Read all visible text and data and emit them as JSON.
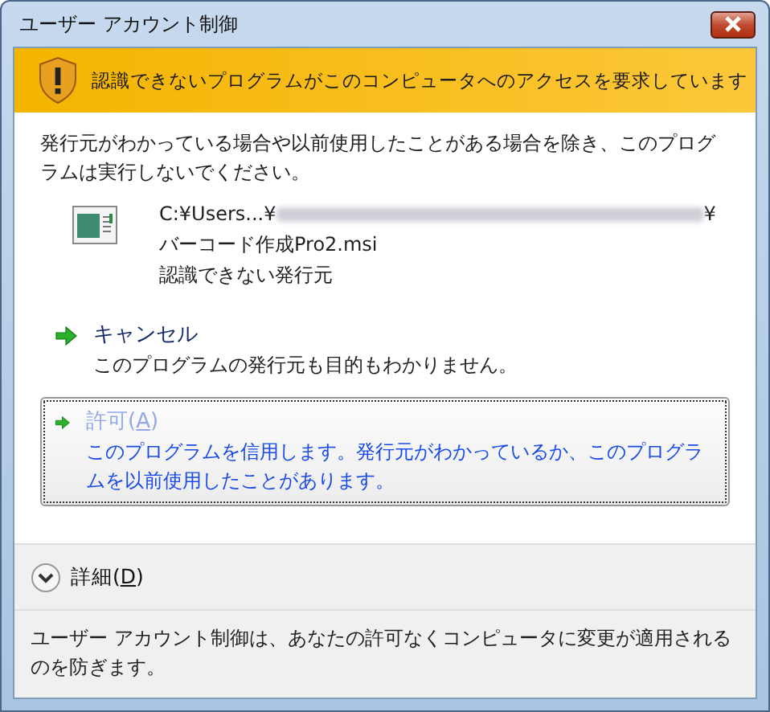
{
  "window": {
    "title": "ユーザー アカウント制御"
  },
  "banner": {
    "text": "認識できないプログラムがこのコンピュータへのアクセスを要求しています"
  },
  "intro": "発行元がわかっている場合や以前使用したことがある場合を除き、このプログラムは実行しないでください。",
  "program": {
    "path_start": "C:¥Users...¥",
    "path_end": "¥",
    "name": "バーコード作成Pro2.msi",
    "publisher": "認識できない発行元"
  },
  "options": [
    {
      "kind": "cancel",
      "label_before": "キャンセル",
      "description": "このプログラムの発行元も目的もわかりません。",
      "focused": false
    },
    {
      "kind": "allow",
      "label_before": "許可(",
      "access_key": "A",
      "label_after": ")",
      "description": "このプログラムを信用します。発行元がわかっているか、このプログラムを以前使用したことがあります。",
      "focused": true
    }
  ],
  "details": {
    "label_before": "詳細(",
    "access_key": "D",
    "label_after": ")",
    "expanded": false
  },
  "footer": "ユーザー アカウント制御は、あなたの許可なくコンピュータに変更が適用されるのを防ぎます。"
}
